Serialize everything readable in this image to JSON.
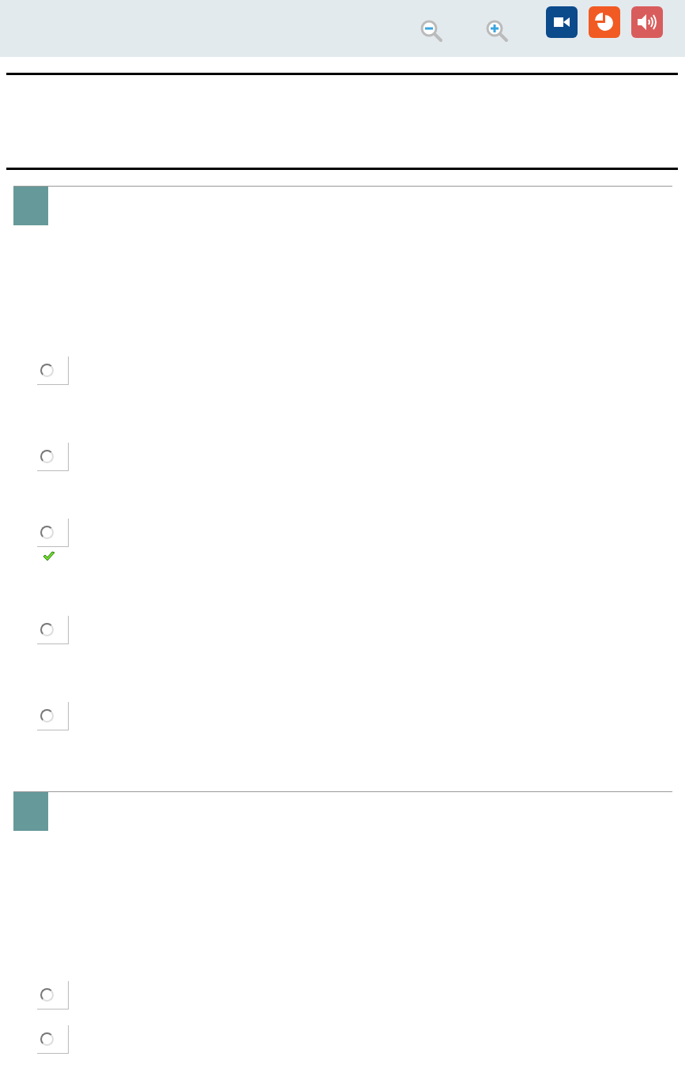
{
  "toolbar": {
    "buttons": [
      {
        "kind": "zoom-out"
      },
      {
        "kind": "zoom-in"
      },
      {
        "kind": "video"
      },
      {
        "kind": "chart"
      },
      {
        "kind": "audio"
      }
    ]
  },
  "questions": [
    {
      "options": [
        {
          "selected": false,
          "correct": false
        },
        {
          "selected": false,
          "correct": false
        },
        {
          "selected": false,
          "correct": true
        },
        {
          "selected": false,
          "correct": false
        },
        {
          "selected": false,
          "correct": false
        }
      ]
    },
    {
      "options": [
        {
          "selected": false,
          "correct": false
        },
        {
          "selected": false,
          "correct": false
        }
      ]
    }
  ]
}
